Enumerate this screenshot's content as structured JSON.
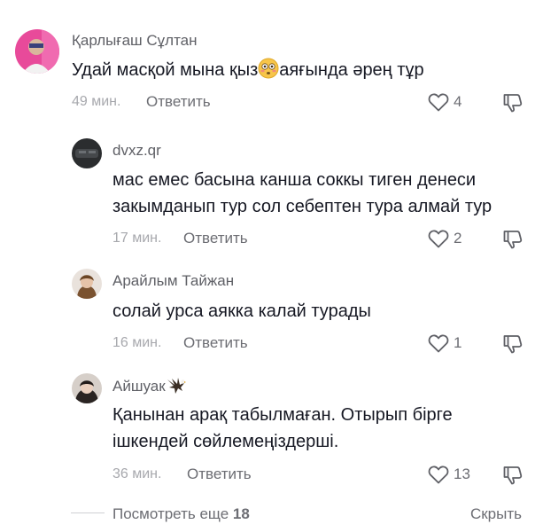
{
  "comments": [
    {
      "username": "Қарлығаш Сұлтан",
      "text_before": "Удай масқой мына қыз",
      "emoji": "flushed-face",
      "text_after": "аяғында әрең тұр",
      "time": "49 мин.",
      "reply_label": "Ответить",
      "likes": "4"
    },
    {
      "username": "dvxz.qr",
      "text_line1": "мас емес басына канша соккы тиген денеси",
      "text_line2": "закымданып тур сол себептен тура алмай тур",
      "time": "17 мин.",
      "reply_label": "Ответить",
      "likes": "2"
    },
    {
      "username": "Арайлым Тайжан",
      "text": "солай урса аякка калай турады",
      "time": "16 мин.",
      "reply_label": "Ответить",
      "likes": "1"
    },
    {
      "username": "Айшуак",
      "username_emoji": "eagle",
      "text_line1": "Қанынан арақ табылмаған. Отырып бірге",
      "text_line2": "ішкендей сөйлемеңіздерші.",
      "time": "36 мин.",
      "reply_label": "Ответить",
      "likes": "13"
    }
  ],
  "footer": {
    "more_label": "Посмотреть еще",
    "more_count": "18",
    "hide_label": "Скрыть"
  },
  "icons": {
    "like": "heart-outline-icon",
    "dislike": "thumbs-down-outline-icon"
  },
  "colors": {
    "text": "#161823",
    "secondary": "#6c6d73",
    "muted": "#a7a8ad"
  }
}
